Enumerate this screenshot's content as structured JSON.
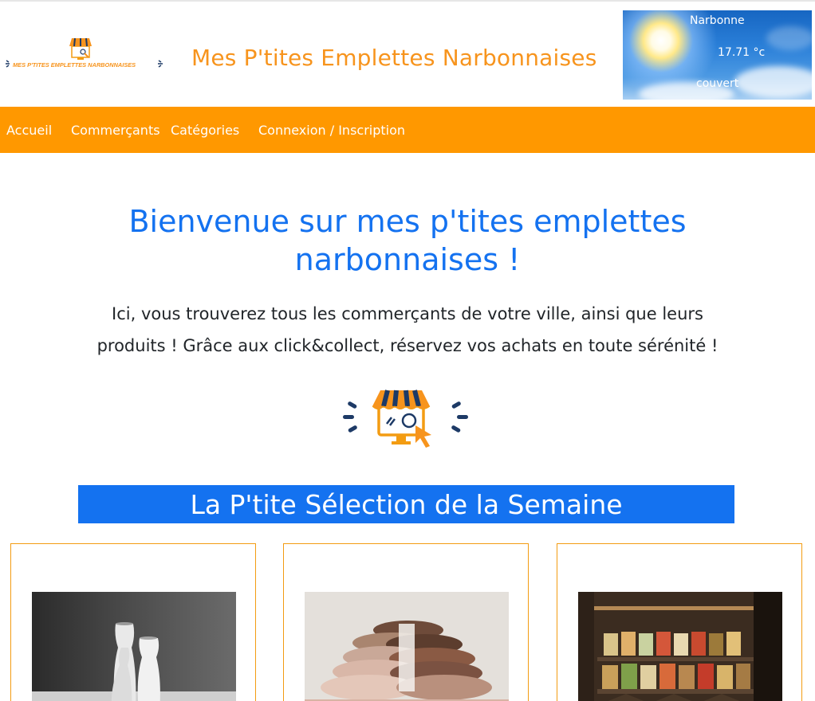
{
  "header": {
    "logo_alt": "Mes P'tites Emplettes Narbonnaises",
    "logo_text": "MES P'TITES EMPLETTES NARBONNAISES",
    "site_title": "Mes P'tites Emplettes Narbonnaises"
  },
  "weather": {
    "city": "Narbonne",
    "temperature": "17.71 °c",
    "description": "couvert"
  },
  "nav": {
    "items": [
      {
        "label": "Accueil"
      },
      {
        "label": "Commerçants"
      },
      {
        "label": "Catégories"
      },
      {
        "label": "Connexion / Inscription"
      }
    ]
  },
  "hero": {
    "title_line1": "Bienvenue sur mes p'tites emplettes",
    "title_line2": "narbonnaises !",
    "text_line1": "Ici, vous trouverez tous les commerçants de votre ville, ainsi que leurs",
    "text_line2": "produits ! Grâce aux click&collect, réservez vos achats en toute sérénité !"
  },
  "selection": {
    "title": "La P'tite Sélection de la Semaine",
    "cards": [
      {
        "image": "white-vases-photo"
      },
      {
        "image": "yarn-skeins-photo"
      },
      {
        "image": "spice-jars-shelf-photo"
      }
    ]
  },
  "colors": {
    "accent_orange": "#ff9800",
    "title_orange": "#f7941d",
    "primary_blue": "#1472f0",
    "logo_navy": "#1d3a66"
  }
}
